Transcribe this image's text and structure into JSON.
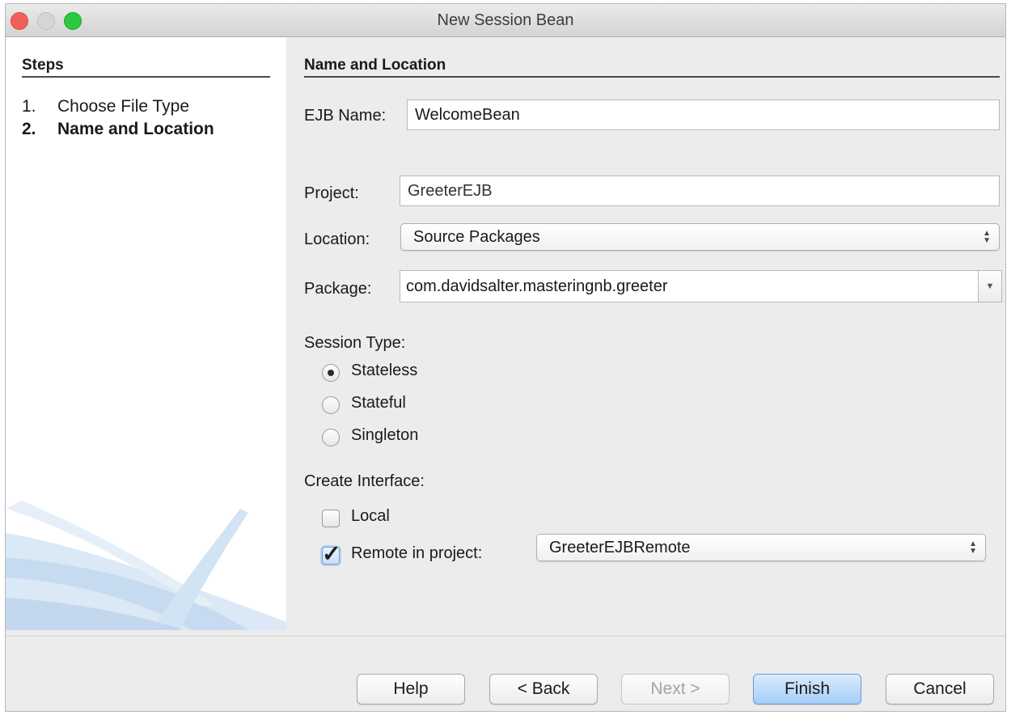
{
  "window": {
    "title": "New Session Bean",
    "traffic_colors": {
      "close": "#f25f57",
      "minimize": "#d6d6d6",
      "zoom": "#29c940"
    }
  },
  "steps": {
    "heading": "Steps",
    "items": [
      {
        "number": "1.",
        "label": "Choose File Type",
        "current": false
      },
      {
        "number": "2.",
        "label": "Name and Location",
        "current": true
      }
    ]
  },
  "form": {
    "section_title": "Name and Location",
    "ejb_name": {
      "label": "EJB Name:",
      "value": "WelcomeBean"
    },
    "project": {
      "label": "Project:",
      "value": "GreeterEJB"
    },
    "location": {
      "label": "Location:",
      "value": "Source Packages"
    },
    "package": {
      "label": "Package:",
      "value": "com.davidsalter.masteringnb.greeter"
    },
    "session_type": {
      "label": "Session Type:",
      "options": [
        {
          "label": "Stateless",
          "selected": true
        },
        {
          "label": "Stateful",
          "selected": false
        },
        {
          "label": "Singleton",
          "selected": false
        }
      ]
    },
    "create_interface": {
      "label": "Create Interface:",
      "local": {
        "label": "Local",
        "checked": false
      },
      "remote": {
        "label": "Remote in project:",
        "checked": true,
        "project": "GreeterEJBRemote"
      }
    }
  },
  "buttons": {
    "help": "Help",
    "back": "< Back",
    "next": "Next >",
    "finish": "Finish",
    "cancel": "Cancel"
  },
  "colors": {
    "accent": "#a5cdf7",
    "panel": "#ececec",
    "steps_bg": "#ffffff"
  }
}
